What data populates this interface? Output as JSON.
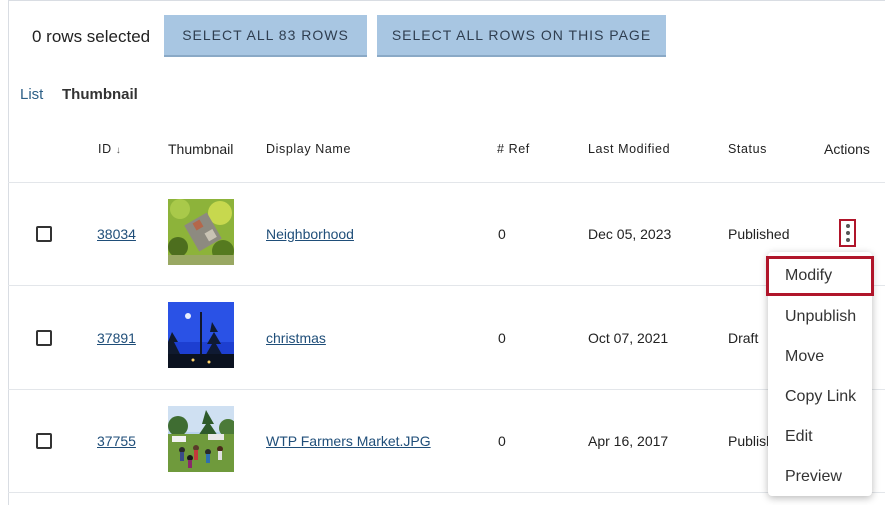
{
  "selection": {
    "count_text": "0 rows selected",
    "select_all_label": "SELECT ALL 83 ROWS",
    "select_page_label": "SELECT ALL ROWS ON THIS PAGE"
  },
  "view_toggle": {
    "list_label": "List",
    "thumbnail_label": "Thumbnail",
    "active": "Thumbnail"
  },
  "table": {
    "headers": {
      "id": "ID",
      "id_sort": "↓",
      "thumbnail": "Thumbnail",
      "display_name": "Display Name",
      "ref": "# Ref",
      "last_modified": "Last Modified",
      "status": "Status",
      "actions": "Actions"
    },
    "rows": [
      {
        "id": "38034",
        "display_name": "Neighborhood",
        "ref": "0",
        "last_modified": "Dec 05, 2023",
        "status": "Published"
      },
      {
        "id": "37891",
        "display_name": "christmas",
        "ref": "0",
        "last_modified": "Oct 07, 2021",
        "status": "Draft"
      },
      {
        "id": "37755",
        "display_name": "WTP Farmers Market.JPG",
        "ref": "0",
        "last_modified": "Apr 16, 2017",
        "status": "Publish"
      }
    ]
  },
  "actions_menu": {
    "items": [
      "Modify",
      "Unpublish",
      "Move",
      "Copy Link",
      "Edit",
      "Preview"
    ],
    "highlighted": "Modify"
  },
  "colors": {
    "button_bg": "#a8c6e2",
    "link": "#1f4e79",
    "highlight_border": "#b0152a"
  }
}
